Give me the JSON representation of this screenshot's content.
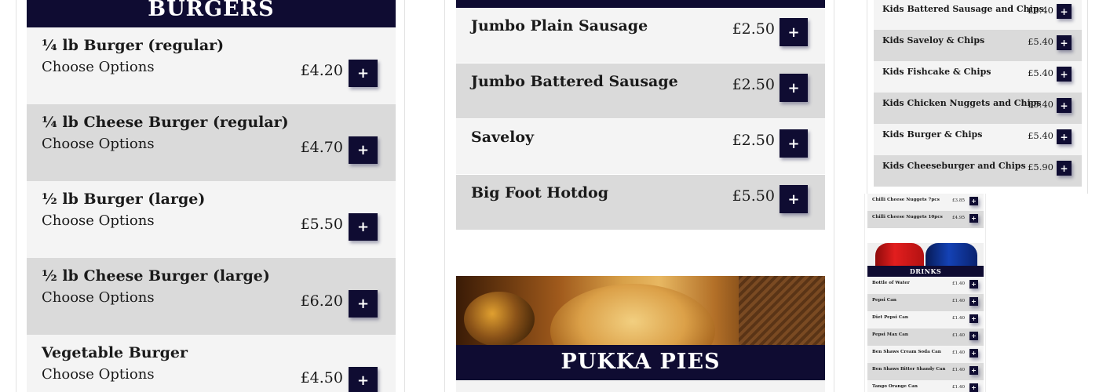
{
  "burgers": {
    "title": "BURGERS",
    "items": [
      {
        "name": "¼ lb Burger (regular)",
        "options": "Choose Options",
        "price": "£4.20",
        "add": "+"
      },
      {
        "name": "¼ lb Cheese Burger (regular)",
        "options": "Choose Options",
        "price": "£4.70",
        "add": "+"
      },
      {
        "name": "½ lb Burger (large)",
        "options": "Choose Options",
        "price": "£5.50",
        "add": "+"
      },
      {
        "name": "½ lb Cheese Burger (large)",
        "options": "Choose Options",
        "price": "£6.20",
        "add": "+"
      },
      {
        "name": "Vegetable Burger",
        "options": "Choose Options",
        "price": "£4.50",
        "add": "+"
      }
    ]
  },
  "sausages": {
    "items": [
      {
        "name": "Jumbo Plain Sausage",
        "price": "£2.50",
        "add": "+"
      },
      {
        "name": "Jumbo Battered Sausage",
        "price": "£2.50",
        "add": "+"
      },
      {
        "name": "Saveloy",
        "price": "£2.50",
        "add": "+"
      },
      {
        "name": "Big Foot Hotdog",
        "price": "£5.50",
        "add": "+"
      }
    ]
  },
  "pies": {
    "title": "PUKKA PIES"
  },
  "kids": {
    "items": [
      {
        "name": "Kids Battered Sausage and Chips",
        "price": "£5.40",
        "add": "+"
      },
      {
        "name": "Kids Saveloy & Chips",
        "price": "£5.40",
        "add": "+"
      },
      {
        "name": "Kids Fishcake & Chips",
        "price": "£5.40",
        "add": "+"
      },
      {
        "name": "Kids Chicken Nuggets and Chips",
        "price": "£5.40",
        "add": "+"
      },
      {
        "name": "Kids Burger & Chips",
        "price": "£5.40",
        "add": "+"
      },
      {
        "name": "Kids Cheeseburger and Chips",
        "price": "£5.90",
        "add": "+"
      }
    ]
  },
  "mini": {
    "nuggets": [
      {
        "name": "Chilli Cheese Nuggets 7pcs",
        "price": "£3.85",
        "add": "+"
      },
      {
        "name": "Chilli Cheese Nuggets 10pcs",
        "price": "£4.95",
        "add": "+"
      }
    ],
    "drinks_title": "DRINKS",
    "drinks": [
      {
        "name": "Bottle of Water",
        "price": "£1.40",
        "add": "+"
      },
      {
        "name": "Pepsi Can",
        "price": "£1.40",
        "add": "+"
      },
      {
        "name": "Diet Pepsi Can",
        "price": "£1.40",
        "add": "+"
      },
      {
        "name": "Pepsi Max Can",
        "price": "£1.40",
        "add": "+"
      },
      {
        "name": "Ben Shaws Cream Soda Can",
        "price": "£1.40",
        "add": "+"
      },
      {
        "name": "Ben Shaws Bitter Shandy Can",
        "price": "£1.40",
        "add": "+"
      },
      {
        "name": "Tango Orange Can",
        "price": "£1.40",
        "add": "+"
      }
    ]
  }
}
